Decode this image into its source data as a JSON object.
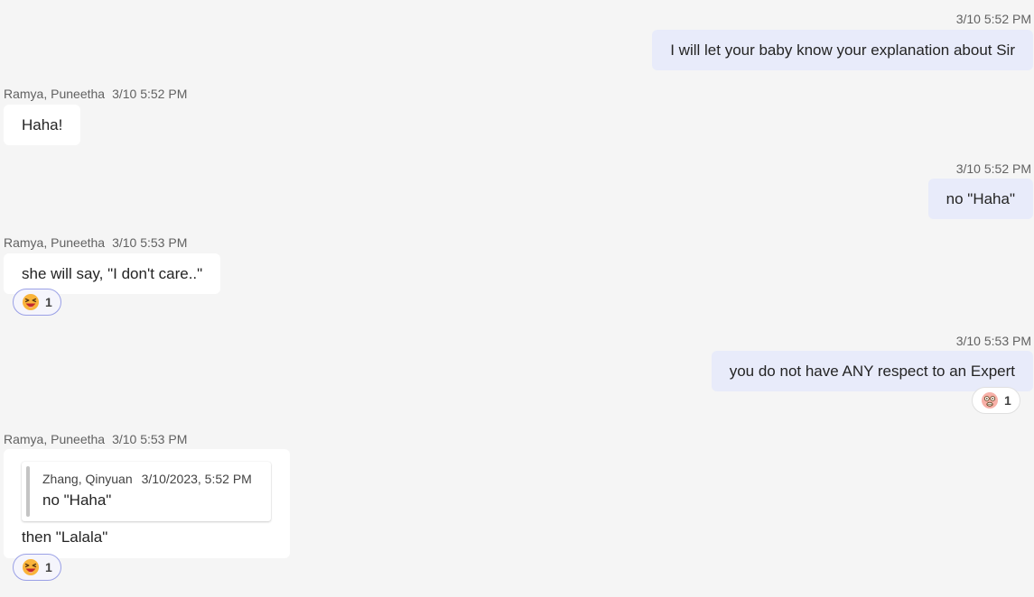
{
  "messages": [
    {
      "direction": "outgoing",
      "timestamp": "3/10 5:52 PM",
      "text": "I will let your baby know your explanation about Sir"
    },
    {
      "direction": "incoming",
      "sender": "Ramya, Puneetha",
      "timestamp": "3/10 5:52 PM",
      "text": "Haha!"
    },
    {
      "direction": "outgoing",
      "timestamp": "3/10 5:52 PM",
      "text": "no \"Haha\""
    },
    {
      "direction": "incoming",
      "sender": "Ramya, Puneetha",
      "timestamp": "3/10 5:53 PM",
      "text": "she will say, \"I don't care..\"",
      "reaction": {
        "icon": "laughing-squint-emoji-icon",
        "count": "1"
      }
    },
    {
      "direction": "outgoing",
      "timestamp": "3/10 5:53 PM",
      "text": "you do not have ANY respect to an Expert",
      "reaction": {
        "icon": "dizzy-face-emoji-icon",
        "count": "1"
      }
    },
    {
      "direction": "incoming",
      "sender": "Ramya, Puneetha",
      "timestamp": "3/10 5:53 PM",
      "quote": {
        "sender": "Zhang, Qinyuan",
        "timestamp": "3/10/2023, 5:52 PM",
        "text": "no \"Haha\""
      },
      "text": "then \"Lalala\"",
      "reaction": {
        "icon": "laughing-squint-emoji-icon",
        "count": "1"
      }
    }
  ],
  "colors": {
    "background": "#f5f5f5",
    "outgoing_bubble": "#e8ebfa",
    "incoming_bubble": "#ffffff",
    "meta_text": "#616161",
    "my_reaction_border": "#9aa0e6"
  }
}
